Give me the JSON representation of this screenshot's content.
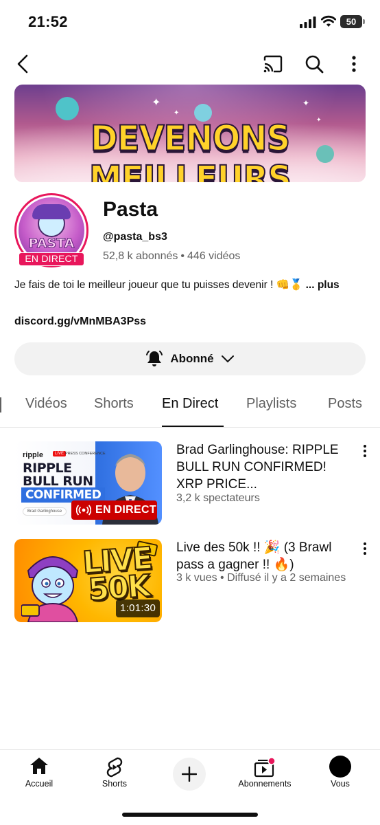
{
  "status_bar": {
    "time": "21:52",
    "battery": "50"
  },
  "top_nav": {
    "icons": [
      "back-icon",
      "cast-icon",
      "search-icon",
      "more-vert-icon"
    ]
  },
  "banner": {
    "text": "DEVENONS MEILLEURS"
  },
  "channel": {
    "avatar_text": "PASTA",
    "live_badge": "EN DIRECT",
    "name": "Pasta",
    "handle": "@pasta_bs3",
    "subscribers": "52,8 k abonnés",
    "separator": "•",
    "videos_count": "446 vidéos",
    "description": "Je fais de toi le meilleur joueur que tu puisses devenir ! 👊🥇",
    "more_label": "... plus",
    "link": "discord.gg/vMnMBA3Pss"
  },
  "subscribe": {
    "label": "Abonné"
  },
  "tabs": {
    "items": [
      {
        "label": "Vidéos"
      },
      {
        "label": "Shorts"
      },
      {
        "label": "En Direct"
      },
      {
        "label": "Playlists"
      },
      {
        "label": "Posts"
      }
    ],
    "active_index": 2
  },
  "videos": [
    {
      "title": "Brad Garlinghouse: RIPPLE BULL RUN CONFIRMED! XRP PRICE...",
      "meta": "3,2 k spectateurs",
      "thumb": {
        "brand": "ripple",
        "live_tag": "LIVE",
        "press": "PRESS CONFERENCE",
        "headline": "RIPPLE BULL RUN",
        "highlight": "CONFIRMED",
        "name_tag": "Brad Garlinghouse",
        "badge": "EN DIRECT"
      }
    },
    {
      "title": "Live des 50k !! 🎉 (3 Brawl pass a gagner !! 🔥)",
      "meta": "3 k vues • Diffusé il y a 2 semaines",
      "thumb": {
        "headline": "LIVE 50K",
        "duration": "1:01:30"
      }
    }
  ],
  "bottom_nav": {
    "items": [
      {
        "label": "Accueil",
        "icon": "home-icon"
      },
      {
        "label": "Shorts",
        "icon": "shorts-icon"
      },
      {
        "label": "",
        "icon": "create-icon"
      },
      {
        "label": "Abonnements",
        "icon": "subscriptions-icon"
      },
      {
        "label": "Vous",
        "icon": "profile-avatar"
      }
    ]
  },
  "colors": {
    "live_red": "#e8165b",
    "badge_red": "#cc0000",
    "text_primary": "#0f0f0f",
    "text_secondary": "#606060"
  }
}
